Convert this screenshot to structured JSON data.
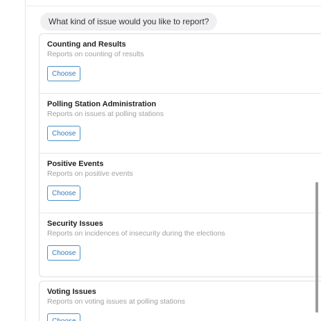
{
  "question": "What kind of issue would you like to report?",
  "options": [
    {
      "title": "Counting and Results",
      "description": "Reports on counting of results",
      "button": "Choose"
    },
    {
      "title": "Polling Station Administration",
      "description": "Reports on issues at polling stations",
      "button": "Choose"
    },
    {
      "title": "Positive Events",
      "description": "Reports on positive events",
      "button": "Choose"
    },
    {
      "title": "Security Issues",
      "description": "Reports on incidences of insecurity during the elections",
      "button": "Choose"
    }
  ],
  "partial_option": {
    "title": "Voting Issues",
    "description": "Reports on voting issues at polling stations",
    "button": "Choose"
  },
  "colors": {
    "accent": "#2f7cc0",
    "bubble": "#f0f0f2",
    "muted_text": "#a0a0a0"
  }
}
